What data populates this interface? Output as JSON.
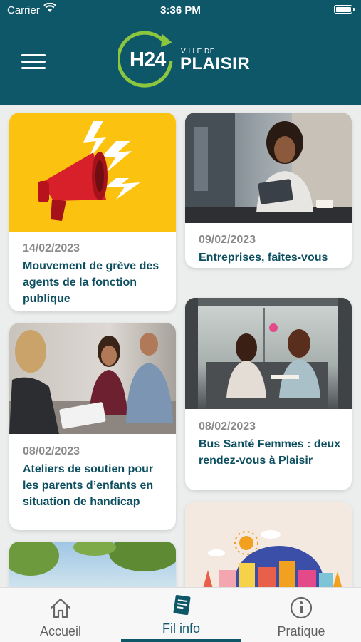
{
  "status_bar": {
    "carrier": "Carrier",
    "time": "3:36 PM"
  },
  "header": {
    "logo_h24": "H24",
    "logo_ville": "VILLE DE",
    "logo_city": "PLAISIR"
  },
  "cards": [
    {
      "date": "14/02/2023",
      "title": "Mouvement de grève des agents de la fonction publique",
      "image": "megaphone-illustration"
    },
    {
      "date": "09/02/2023",
      "title": "Entreprises, faites-vous connaître !",
      "image": "woman-with-tablet-photo"
    },
    {
      "date": "08/02/2023",
      "title": "Ateliers de soutien pour les parents d’enfants en situation de handicap",
      "image": "meeting-photo"
    },
    {
      "date": "08/02/2023",
      "title": "Bus Santé Femmes : deux rendez-vous à Plaisir",
      "image": "bus-interior-photo"
    },
    {
      "date": "",
      "title": "",
      "image": "park-trees-photo"
    },
    {
      "date": "",
      "title": "",
      "image": "city-illustration"
    }
  ],
  "tabs": [
    {
      "label": "Accueil",
      "icon": "home-icon"
    },
    {
      "label": "Fil info",
      "icon": "news-icon",
      "active": true
    },
    {
      "label": "Pratique",
      "icon": "info-icon"
    }
  ],
  "colors": {
    "header": "#0d5769",
    "accent_green": "#8cc63f",
    "title_text": "#0d4f60",
    "megaphone_bg": "#fbc20f"
  }
}
